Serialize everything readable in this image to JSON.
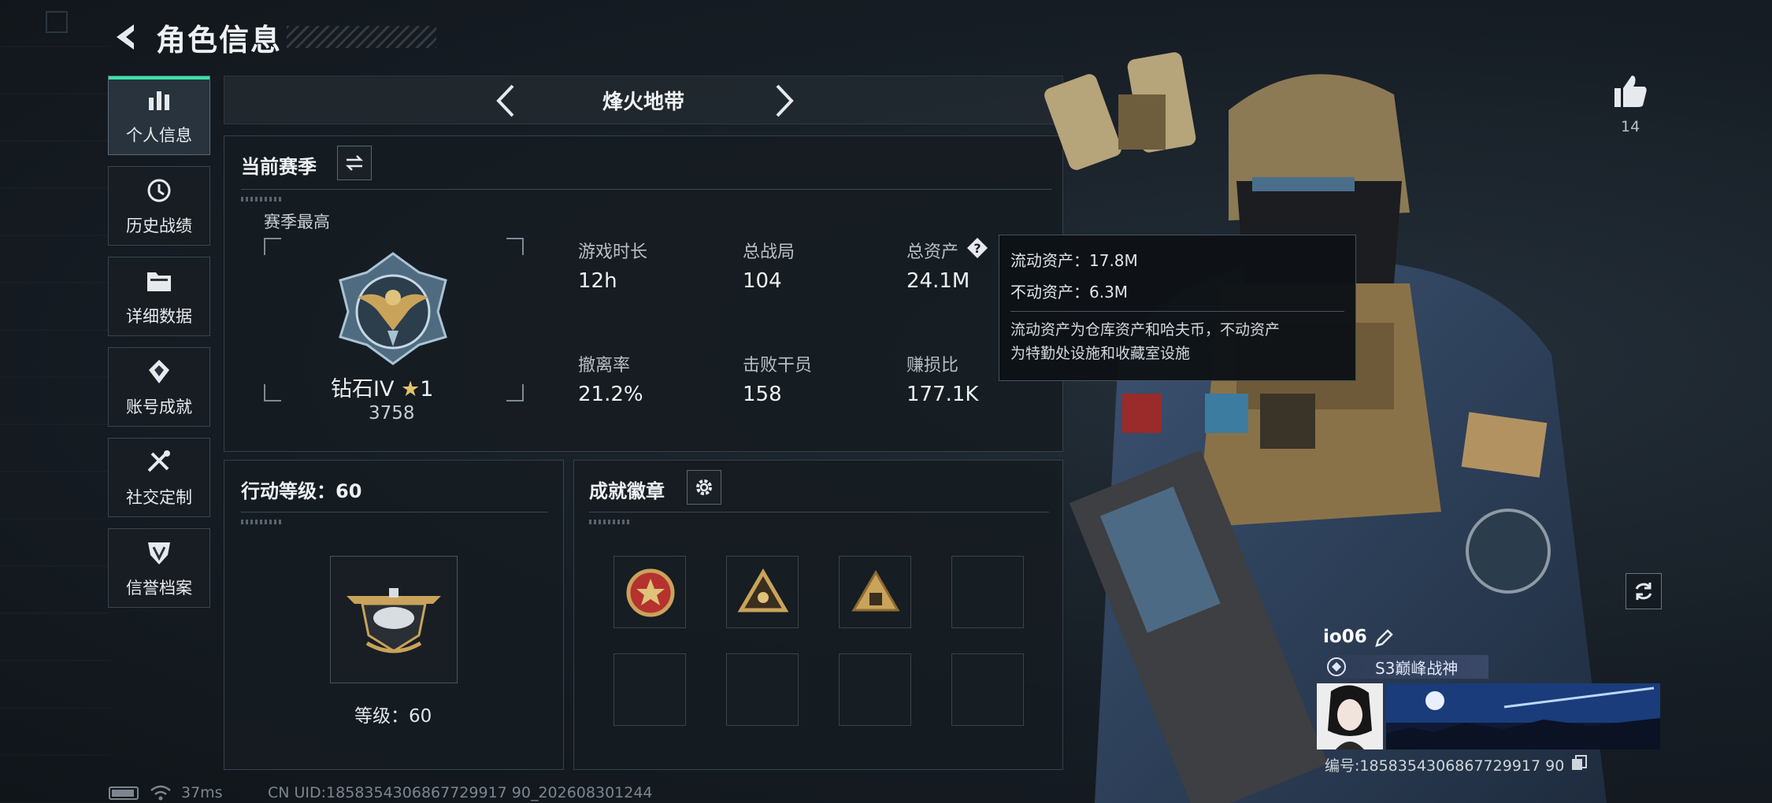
{
  "header": {
    "title": "角色信息"
  },
  "sidebar": {
    "items": [
      {
        "label": "个人信息",
        "icon": "bar-chart-icon",
        "active": true
      },
      {
        "label": "历史战绩",
        "icon": "history-icon",
        "active": false
      },
      {
        "label": "详细数据",
        "icon": "folder-icon",
        "active": false
      },
      {
        "label": "账号成就",
        "icon": "achievement-icon",
        "active": false
      },
      {
        "label": "社交定制",
        "icon": "tools-icon",
        "active": false
      },
      {
        "label": "信誉档案",
        "icon": "reputation-icon",
        "active": false
      }
    ]
  },
  "mode": {
    "title": "烽火地带"
  },
  "season": {
    "title": "当前赛季",
    "best_label": "赛季最高",
    "rank_name": "钻石IV",
    "rank_stars": "1",
    "rank_score": "3758",
    "stats": [
      {
        "label": "游戏时长",
        "value": "12h"
      },
      {
        "label": "总战局",
        "value": "104"
      },
      {
        "label": "总资产",
        "value": "24.1M"
      },
      {
        "label": "撤离率",
        "value": "21.2%"
      },
      {
        "label": "击败干员",
        "value": "158"
      },
      {
        "label": "赚损比",
        "value": "177.1K"
      }
    ]
  },
  "tooltip": {
    "liquid": "流动资产：17.8M",
    "fixed": "不动资产：6.3M",
    "desc_line1": "流动资产为仓库资产和哈夫币，不动资产",
    "desc_line2": "为特勤处设施和收藏室设施"
  },
  "action_level": {
    "title": "行动等级：60",
    "level_text": "等级：60"
  },
  "achievements": {
    "title": "成就徽章",
    "filled_slots": 3,
    "total_slots": 8
  },
  "likes": {
    "count": "14"
  },
  "player": {
    "name": "io06",
    "title": "S3巅峰战神",
    "id_text": "编号:1858354306867729917 90"
  },
  "status_bar": {
    "ping": "37ms",
    "uid": "CN UID:1858354306867729917 90_202608301244"
  },
  "colors": {
    "accent": "#3ee0a8",
    "panel": "#161c22",
    "gold": "#c9a35a"
  }
}
